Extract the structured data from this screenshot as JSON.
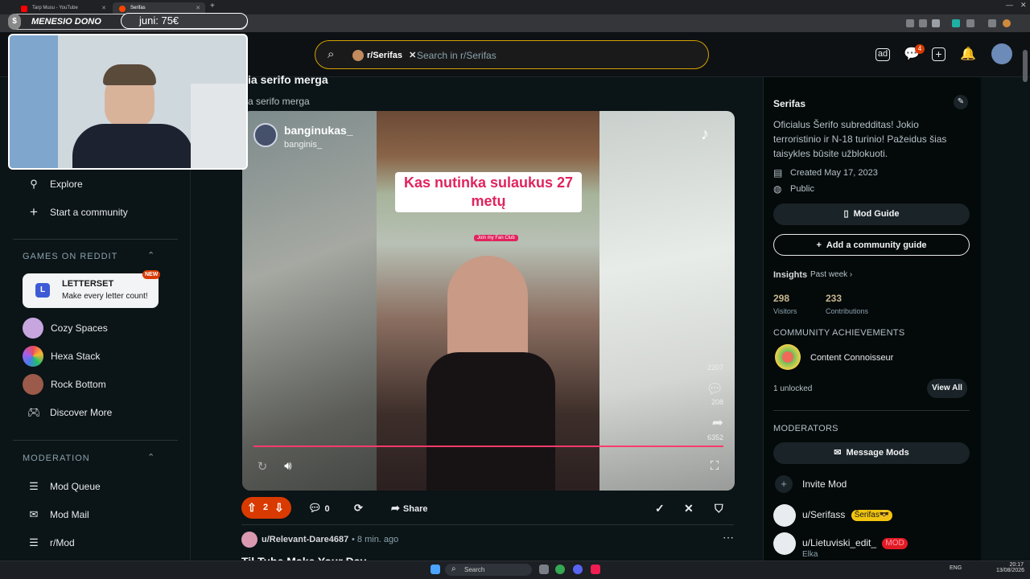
{
  "browser": {
    "tabs": [
      {
        "title": "Tarp Musu - YouTube"
      },
      {
        "title": "Serifas"
      }
    ],
    "new_tab": "+"
  },
  "stream_overlay": {
    "dono_label": "MENESIO DONO",
    "dono_value": "juni: 75€"
  },
  "header": {
    "search_chip": "r/Serifas",
    "search_placeholder": "Search in r/Serifas",
    "notification_count": "4"
  },
  "leftnav": {
    "explore": "Explore",
    "start_community": "Start a community",
    "games_heading": "GAMES ON REDDIT",
    "featured_game": {
      "name": "LETTERSET",
      "tagline": "Make every letter count!",
      "badge": "NEW",
      "icon_letter": "L"
    },
    "games": [
      {
        "name": "Cozy Spaces",
        "color": "#c7a6e0"
      },
      {
        "name": "Hexa Stack",
        "color": "#e84a5f"
      },
      {
        "name": "Rock Bottom",
        "color": "#9b5a4a"
      }
    ],
    "discover_more": "Discover More",
    "moderation_heading": "MODERATION",
    "mod_items": [
      "Mod Queue",
      "Mod Mail",
      "r/Mod"
    ]
  },
  "post": {
    "title": "ia serifo merga",
    "subtitle": "a serifo merga",
    "video": {
      "username": "banginukas_",
      "handle": "banginis_",
      "caption": "Kas nutinka sulaukus 27 metų",
      "fan_club": "Join my Fan Club",
      "count_likes": "2207",
      "count_comments": "208",
      "count_shares": "6352"
    },
    "votes": "2",
    "comments": "0",
    "share_label": "Share"
  },
  "next_post": {
    "author": "u/Relevant-Dare4687",
    "time": "• 8 min. ago",
    "title_partial": "Til Tube Make Your Day"
  },
  "sidebar": {
    "name": "Serifas",
    "description": "Oficialus Šerifo subredditas! Jokio terroristinio ir N-18 turinio! Pažeidus šias taisykles būsite užblokuoti.",
    "created": "Created May 17, 2023",
    "visibility": "Public",
    "mod_guide": "Mod Guide",
    "add_guide": "Add a community guide",
    "insights_label": "Insights",
    "insights_range": "Past week",
    "visitors_value": "298",
    "visitors_label": "Visitors",
    "contributions_value": "233",
    "contributions_label": "Contributions",
    "achievements_heading": "COMMUNITY ACHIEVEMENTS",
    "achievement_name": "Content Connoisseur",
    "unlocked": "1 unlocked",
    "view_all": "View All",
    "moderators_heading": "MODERATORS",
    "message_mods": "Message Mods",
    "invite_mod": "Invite Mod",
    "moderators": [
      {
        "name": "u/Serifass",
        "flair": "Šerifas😎",
        "flair_color": "#f1c40f",
        "flair_text_color": "#1a1a1a"
      },
      {
        "name": "u/Lietuviski_edit_",
        "flair": "MOD",
        "flair_color": "#e01b24",
        "flair_text_color": "#ff9aa8",
        "subtext": "Elka"
      }
    ]
  },
  "taskbar": {
    "search_label": "Search",
    "lang": "ENG",
    "time": "20:17",
    "date": "13/08/2026"
  },
  "colors": {
    "accent_orange": "#d93a00",
    "search_border": "#d4a100",
    "progress": "#ff3b6b"
  }
}
